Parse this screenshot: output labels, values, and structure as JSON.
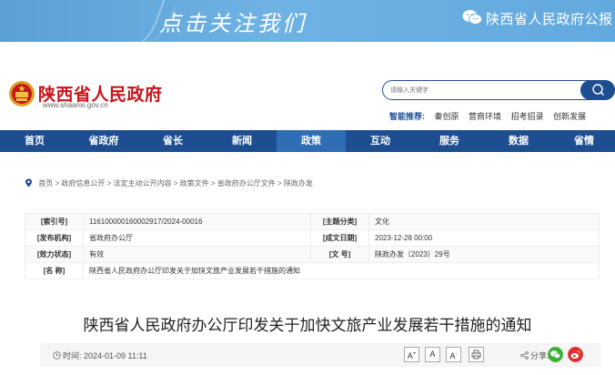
{
  "banner": {
    "follow_text": "点击关注我们",
    "account_name": "陕西省人民政府公报"
  },
  "header": {
    "site_name": "陕西省人民政府",
    "site_url": "www.shaanxi.gov.cn",
    "search_placeholder": "请输入关键字",
    "hot_label": "智能推荐:",
    "hot_links": [
      "秦创原",
      "营商环境",
      "招考招录",
      "创新发展"
    ]
  },
  "nav": [
    "首页",
    "省政府",
    "省长",
    "新闻",
    "政策",
    "互动",
    "服务",
    "数据",
    "省情"
  ],
  "breadcrumb": "首页 > 政府信息公开 > 法定主动公开内容 > 政策文件 > 省政府办公厅文件 > 陕政办发",
  "info": {
    "index_label": "[索引号]",
    "index_value": "116100000160002917/2024-00016",
    "topic_label": "[主题分类]",
    "topic_value": "文化",
    "org_label": "[发布机构]",
    "org_value": "省政府办公厅",
    "date_label": "[成文日期]",
    "date_value": "2023-12-28 00:00",
    "status_label": "[效力状态]",
    "status_value": "有效",
    "docno_label": "[文 号]",
    "docno_value": "陕政办发〔2023〕29号",
    "name_label": "[名 称]",
    "name_value": "陕西省人民政府办公厅印发关于加快文旅产业发展若干措施的通知"
  },
  "title": "陕西省人民政府办公厅印发关于加快文旅产业发展若干措施的通知",
  "toolbar": {
    "time_text": "时间: 2024-01-09 11:11",
    "font_large": "A",
    "font_mid": "A",
    "font_small": "A",
    "share_label": "分享:"
  },
  "colors": {
    "brand_red": "#c8141a",
    "nav_blue": "#1d4e8f",
    "wechat_green": "#3cb034",
    "weibo_red": "#e0312e"
  }
}
